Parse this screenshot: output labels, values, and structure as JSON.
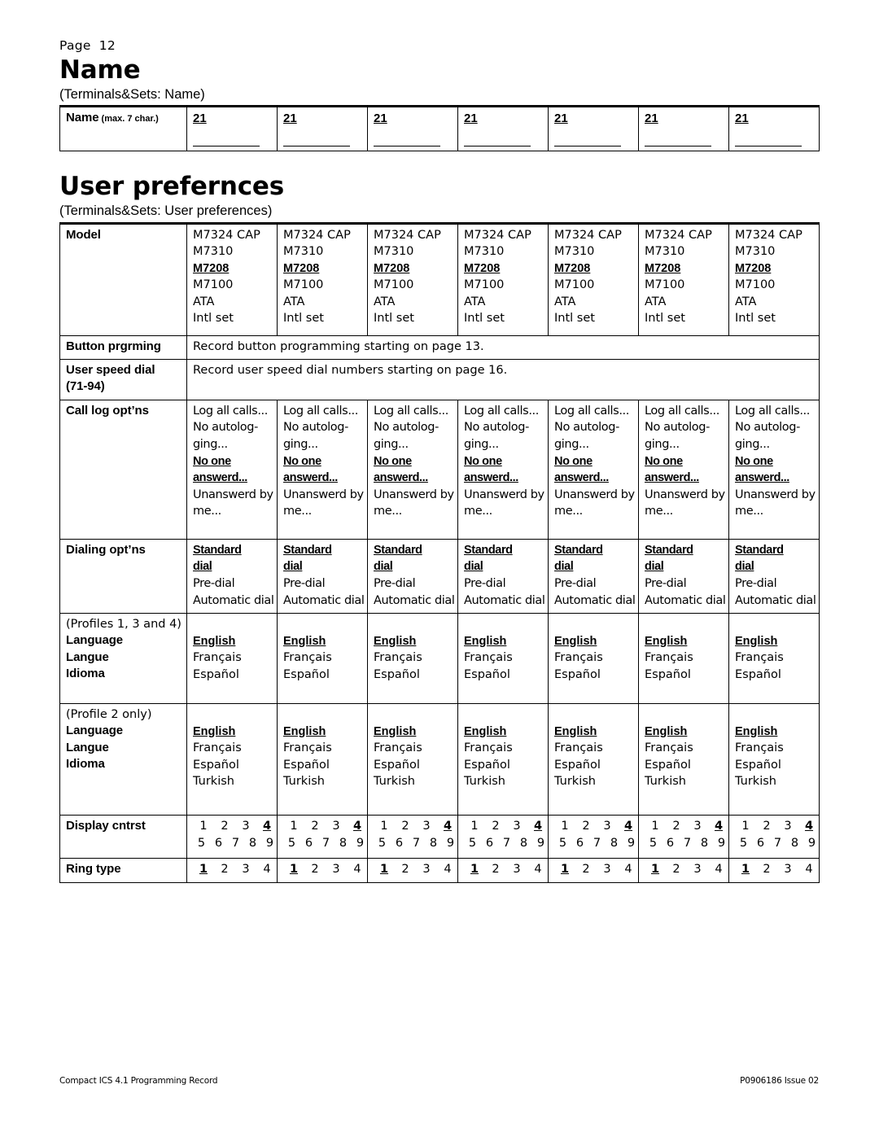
{
  "page": {
    "page_label": "Page",
    "page_number": "12",
    "footer_left": "Compact ICS 4.1 Programming Record",
    "footer_right": "P0906186 Issue 02"
  },
  "name_section": {
    "title": "Name",
    "subtitle": "(Terminals&Sets: Name)",
    "row_label": "Name",
    "row_label_note": "(max. 7 char.)",
    "columns": [
      "21",
      "21",
      "21",
      "21",
      "21",
      "21",
      "21"
    ]
  },
  "user_prefs_section": {
    "title": "User prefernces",
    "subtitle": "(Terminals&Sets: User preferences)",
    "rows": {
      "model": {
        "label": "Model",
        "options": [
          "M7324 CAP",
          "M7310",
          "M7208",
          "M7100",
          "ATA",
          "Intl set"
        ],
        "default": "M7208",
        "columns": 7
      },
      "button_prgrming": {
        "label": "Button prgrming",
        "text": "Record button programming starting on page 13."
      },
      "user_speed_dial": {
        "label_line1": "User speed dial",
        "label_line2": "(71-94)",
        "text": "Record user speed dial numbers starting on page 16."
      },
      "call_log": {
        "label": "Call log opt’ns",
        "options": [
          "Log all calls...",
          "No autolog-",
          "ging...",
          "No one ",
          "answerd...",
          "Unanswerd by",
          "me..."
        ],
        "default_lines": [
          "No one ",
          "answerd..."
        ],
        "columns": 7
      },
      "dialing": {
        "label": "Dialing opt’ns",
        "options": [
          "Standard",
          "dial",
          "Pre-dial",
          "Automatic dial"
        ],
        "default_lines": [
          "Standard",
          "dial"
        ],
        "columns": 7
      },
      "language_134": {
        "label_note": "(Profiles 1, 3 and 4)",
        "label_lines": [
          "Language",
          "Langue",
          "Idioma"
        ],
        "options": [
          "English",
          "Français",
          "Español"
        ],
        "default": "English",
        "columns": 7
      },
      "language_2": {
        "label_note": "(Profile 2 only)",
        "label_lines": [
          "Language",
          "Langue",
          "Idioma"
        ],
        "options": [
          "English",
          "Français",
          "Español",
          "Turkish"
        ],
        "default": "English",
        "columns": 7
      },
      "display_contrast": {
        "label": "Display cntrst",
        "line1": [
          "1",
          "2",
          "3",
          "4"
        ],
        "line2": [
          "5",
          "6",
          "7",
          "8",
          "9"
        ],
        "default": "4",
        "columns": 7
      },
      "ring_type": {
        "label": "Ring type",
        "values": [
          "1",
          "2",
          "3",
          "4"
        ],
        "default": "1",
        "columns": 7
      }
    }
  }
}
